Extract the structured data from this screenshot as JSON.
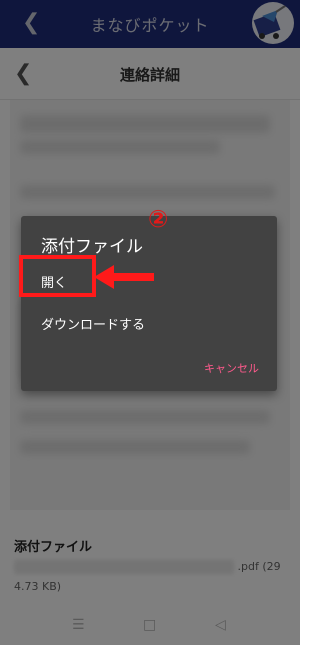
{
  "app_bar": {
    "title": "まなびポケット",
    "back_icon": "chevron-left-icon"
  },
  "page_header": {
    "title": "連絡詳細",
    "back_icon": "chevron-left-icon"
  },
  "attachments": {
    "heading": "添付ファイル",
    "file_ext": ".pdf",
    "file_size_part1": "(29",
    "file_size_part2": "4.73 KB)"
  },
  "dialog": {
    "title": "添付ファイル",
    "options": [
      {
        "label": "開く"
      },
      {
        "label": "ダウンロードする"
      }
    ],
    "cancel_label": "キャンセル"
  },
  "annotation": {
    "step": "②",
    "highlight_color": "#ff1a1a"
  },
  "nav_bar": {
    "icons": [
      "menu-icon",
      "home-square-icon",
      "back-triangle-icon"
    ]
  },
  "colors": {
    "app_bar_bg": "#1f2d7a",
    "dialog_bg": "#424242",
    "accent": "#ff5a8c"
  }
}
